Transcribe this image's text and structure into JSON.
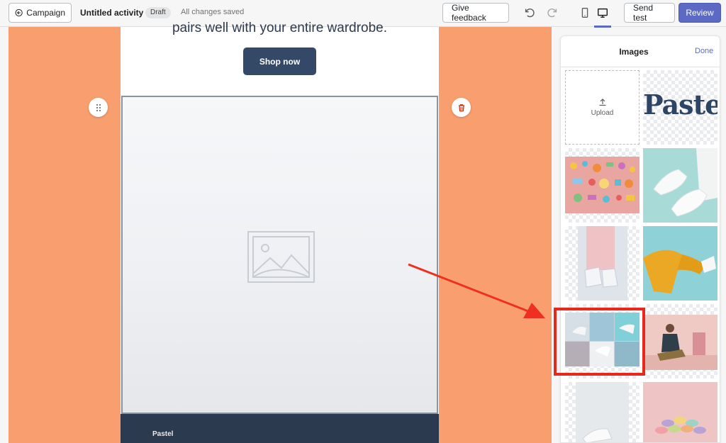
{
  "topbar": {
    "back_label": "Campaign",
    "title": "Untitled activity",
    "badge": "Draft",
    "status": "All changes saved",
    "feedback_label": "Give feedback",
    "send_test_label": "Send test",
    "review_label": "Review"
  },
  "email": {
    "tagline": "pairs well with your entire wardrobe.",
    "cta_label": "Shop now",
    "footer_brand": "Pastel"
  },
  "panel": {
    "title": "Images",
    "done_label": "Done",
    "upload_label": "Upload",
    "brand_wordmark": "Pastel"
  },
  "colors": {
    "accent": "#5c6ac4",
    "canvas_background": "#f99f6f",
    "cta_background": "#344967",
    "highlight": "#e8281d"
  }
}
